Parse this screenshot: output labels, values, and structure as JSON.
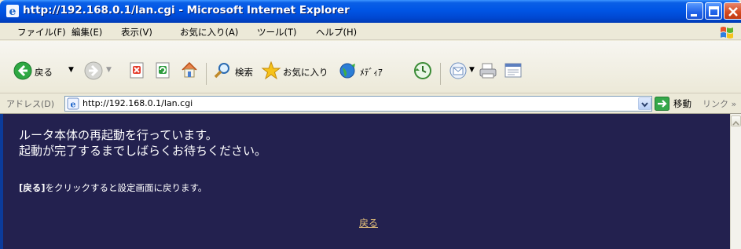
{
  "window": {
    "title": "http://192.168.0.1/lan.cgi - Microsoft Internet Explorer"
  },
  "menu": {
    "items": [
      "ファイル(F)",
      "編集(E)",
      "表示(V)",
      "お気に入り(A)",
      "ツール(T)",
      "ヘルプ(H)"
    ]
  },
  "toolbar": {
    "back_label": "戻る",
    "search_label": "検索",
    "favorites_label": "お気に入り",
    "media_label": "ﾒﾃﾞｨｱ"
  },
  "address": {
    "label": "アドレス(D)",
    "url": "http://192.168.0.1/lan.cgi",
    "go_label": "移動",
    "links_label": "リンク »"
  },
  "page": {
    "message_line1": "ルータ本体の再起動を行っています。",
    "message_line2": "起動が完了するまでしばらくお待ちください。",
    "note_bold": "[戻る]",
    "note_rest": "をクリックすると設定画面に戻ります。",
    "back_link": "戻る"
  },
  "colors": {
    "content_background": "#23214f",
    "link": "#e6c27a",
    "titlebar": "#0055e5"
  }
}
